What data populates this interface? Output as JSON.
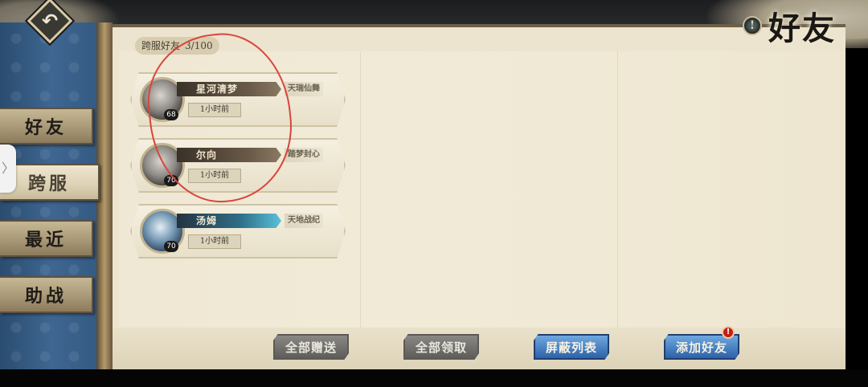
{
  "header": {
    "back_icon": "back-arrow-icon",
    "title_icon": "exclamation-icon",
    "title_icon_glyph": "!",
    "title": "好友"
  },
  "sidebar": {
    "tabs": [
      {
        "label": "好友",
        "active": false
      },
      {
        "label": "跨服",
        "active": true
      },
      {
        "label": "最近",
        "active": false
      },
      {
        "label": "助战",
        "active": false
      }
    ],
    "handle_glyph": "〉"
  },
  "panel": {
    "section_label": "跨服好友",
    "count": "3/100"
  },
  "friends": [
    {
      "name": "星河清梦",
      "server": "天瑞仙舞",
      "time": "1小时前",
      "level": "68",
      "name_style": "normal"
    },
    {
      "name": "尔向",
      "server": "踏梦封心",
      "time": "1小时前",
      "level": "70",
      "name_style": "normal"
    },
    {
      "name": "汤姆",
      "server": "天地战纪",
      "time": "1小时前",
      "level": "70",
      "name_style": "special"
    }
  ],
  "actions": [
    {
      "label": "全部赠送",
      "style": "gray"
    },
    {
      "label": "全部领取",
      "style": "gray"
    },
    {
      "label": "屏蔽列表",
      "style": "blue"
    },
    {
      "label": "添加好友",
      "style": "blue"
    }
  ],
  "add_friend_badge": "!",
  "colors": {
    "accent_blue": "#2d62a8",
    "annotation_red": "#d9453b",
    "panel_bg": "#ece4cf"
  }
}
